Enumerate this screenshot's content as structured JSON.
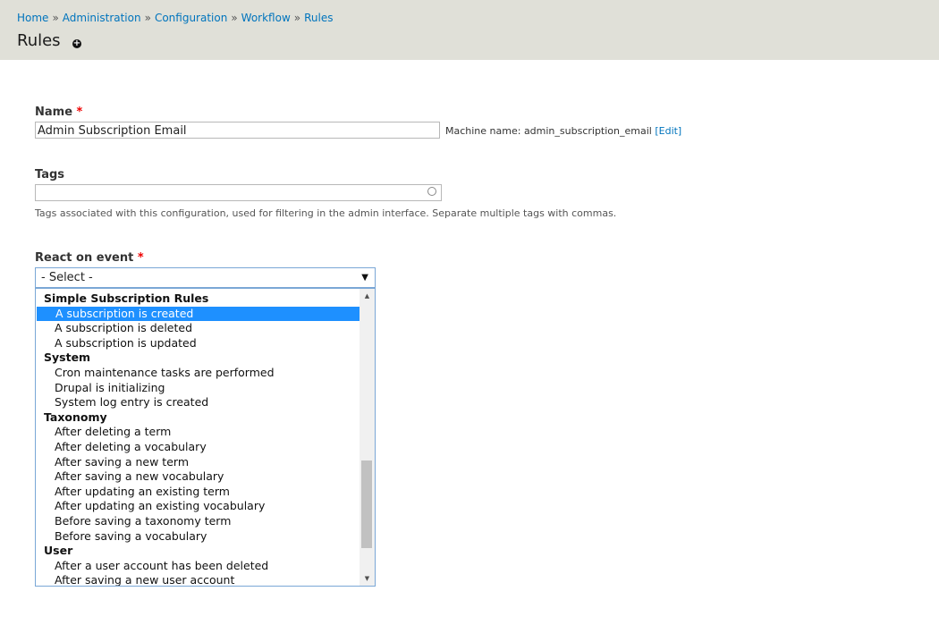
{
  "breadcrumb": [
    "Home",
    "Administration",
    "Configuration",
    "Workflow",
    "Rules"
  ],
  "breadcrumb_sep": "»",
  "page": {
    "title": "Rules",
    "add_icon": "+"
  },
  "name_field": {
    "label": "Name",
    "required": "*",
    "value": "Admin Subscription Email",
    "machine_name_prefix": "Machine name: admin_subscription_email",
    "edit_link": "[Edit]"
  },
  "tags_field": {
    "label": "Tags",
    "value": "",
    "description": "Tags associated with this configuration, used for filtering in the admin interface. Separate multiple tags with commas."
  },
  "event_field": {
    "label": "React on event",
    "required": "*",
    "selected": "- Select -",
    "rows": [
      {
        "type": "group",
        "label": "Simple Subscription Rules"
      },
      {
        "type": "option",
        "label": "A subscription is created",
        "highlighted": true
      },
      {
        "type": "option",
        "label": "A subscription is deleted"
      },
      {
        "type": "option",
        "label": "A subscription is updated"
      },
      {
        "type": "group",
        "label": "System"
      },
      {
        "type": "option",
        "label": "Cron maintenance tasks are performed"
      },
      {
        "type": "option",
        "label": "Drupal is initializing"
      },
      {
        "type": "option",
        "label": "System log entry is created"
      },
      {
        "type": "group",
        "label": "Taxonomy"
      },
      {
        "type": "option",
        "label": "After deleting a term"
      },
      {
        "type": "option",
        "label": "After deleting a vocabulary"
      },
      {
        "type": "option",
        "label": "After saving a new term"
      },
      {
        "type": "option",
        "label": "After saving a new vocabulary"
      },
      {
        "type": "option",
        "label": "After updating an existing term"
      },
      {
        "type": "option",
        "label": "After updating an existing vocabulary"
      },
      {
        "type": "option",
        "label": "Before saving a taxonomy term"
      },
      {
        "type": "option",
        "label": "Before saving a vocabulary"
      },
      {
        "type": "group",
        "label": "User"
      },
      {
        "type": "option",
        "label": "After a user account has been deleted"
      },
      {
        "type": "option",
        "label": "After saving a new user account"
      }
    ]
  },
  "colors": {
    "link": "#0074bd",
    "header_bg": "#e0e0d8",
    "highlight": "#1e90ff",
    "required": "#e00000"
  },
  "icons": {
    "add": "add-circle-icon",
    "tags_autocomplete": "autocomplete-throbber-icon",
    "select": "dropdown-arrow-icon"
  }
}
